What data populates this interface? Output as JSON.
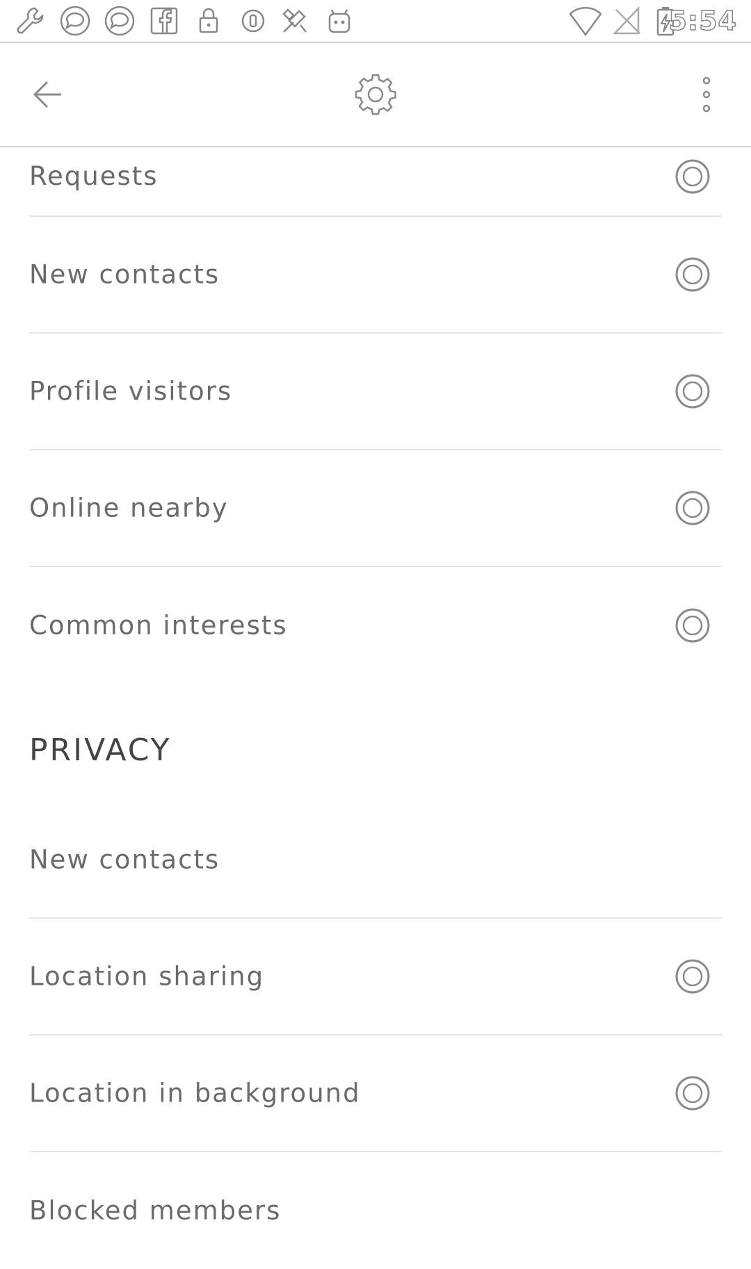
{
  "status_bar": {
    "time": "5:54",
    "left_icons": [
      "wrench-icon",
      "chat-icon",
      "chat-icon",
      "facebook-icon",
      "lock-icon",
      "circle-icon",
      "app-icon",
      "android-icon"
    ],
    "right_icons": [
      "wifi-icon",
      "no-signal-icon",
      "battery-charging-icon"
    ]
  },
  "toolbar": {
    "back_icon": "back-arrow-icon",
    "title_icon": "gear-icon",
    "menu_icon": "more-vert-icon"
  },
  "notifications": {
    "items": [
      {
        "label": "Requests"
      },
      {
        "label": "New contacts"
      },
      {
        "label": "Profile visitors"
      },
      {
        "label": "Online nearby"
      },
      {
        "label": "Common interests"
      }
    ]
  },
  "privacy": {
    "header": "PRIVACY",
    "items": [
      {
        "label": "New contacts"
      },
      {
        "label": "Location sharing"
      },
      {
        "label": "Location in background"
      },
      {
        "label": "Blocked members"
      }
    ]
  },
  "colors": {
    "text": "#6a6a6a",
    "divider": "#e4e4e4",
    "icon": "#8a8a8a"
  }
}
